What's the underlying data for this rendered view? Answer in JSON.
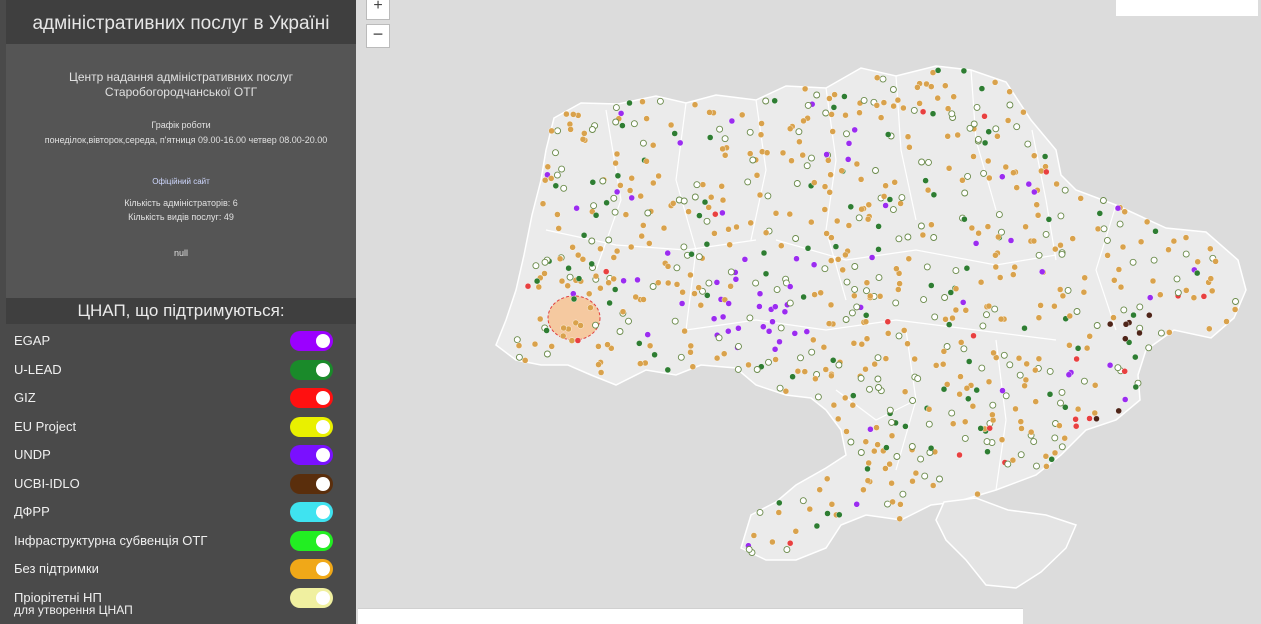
{
  "sidebar": {
    "header_line1": "",
    "header_line2": "адміністративних послуг в Україні",
    "info": {
      "center_name": "Центр надання адміністративних послуг Старобогородчанської ОТГ",
      "schedule_title": "Графік роботи",
      "schedule": "понеділок,вівторок,середа, п'ятниця 09.00-16.00 четвер 08.00-20.00",
      "site": "Офіційний сайт",
      "admins": "Кількість адміністраторів: 6",
      "services": "Кількість видів послуг: 49",
      "null_value": "null"
    },
    "legend_title": "ЦНАП, що підтримуються:",
    "legend": [
      {
        "label": "EGAP",
        "color": "#9b00ff"
      },
      {
        "label": "U-LEAD",
        "color": "#1a8a2a"
      },
      {
        "label": "GIZ",
        "color": "#ff1010"
      },
      {
        "label": "EU Project",
        "color": "#e9f000"
      },
      {
        "label": "UNDP",
        "color": "#7a10ff"
      },
      {
        "label": "UCBI-IDLO",
        "color": "#5a2e0c"
      },
      {
        "label": "ДФРР",
        "color": "#3fe3f0"
      },
      {
        "label": "Інфраструктурна субвенція ОТГ",
        "color": "#22ee22"
      },
      {
        "label": "Без підтримки",
        "color": "#f0a818"
      },
      {
        "label": "Пріорітетні НП",
        "label2": "для утворення ЦНАП",
        "color": "#f0f0a0"
      }
    ]
  },
  "map": {
    "zoom_in": "+",
    "zoom_out": "−",
    "region_fill": "#ebebeb",
    "crimea_fill": "#e4e4e4",
    "highlight_fill": "#f5c9a0",
    "dot_colors": {
      "none": "#d9a24c",
      "priority": "#ffffff",
      "egap": "#9b2cf0",
      "ulead": "#2e7d32",
      "ucbi": "#4e2418",
      "giz": "#e84040"
    }
  }
}
